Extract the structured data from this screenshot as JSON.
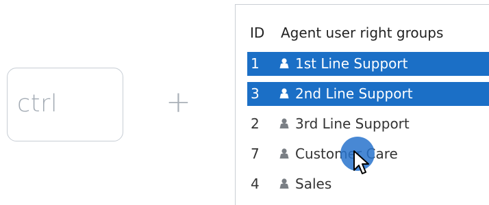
{
  "modifier_key": {
    "label": "ctrl"
  },
  "combine_symbol": "+",
  "table": {
    "columns": {
      "id": "ID",
      "name": "Agent user right groups"
    },
    "rows": [
      {
        "id": "1",
        "name": "1st Line Support",
        "selected": true,
        "icon": "user-group-icon"
      },
      {
        "id": "3",
        "name": "2nd Line Support",
        "selected": true,
        "icon": "user-group-icon"
      },
      {
        "id": "2",
        "name": "3rd Line Support",
        "selected": false,
        "icon": "user-group-icon"
      },
      {
        "id": "7",
        "name": "Customer Care",
        "selected": false,
        "icon": "user-group-icon"
      },
      {
        "id": "4",
        "name": "Sales",
        "selected": false,
        "icon": "user-group-icon"
      }
    ]
  },
  "colors": {
    "selection": "#1b6fc6",
    "click_indicator": "#2873cd",
    "key_border": "#c7cdd4",
    "text": "#333333"
  },
  "cursor": {
    "icon": "mouse-pointer-icon"
  }
}
